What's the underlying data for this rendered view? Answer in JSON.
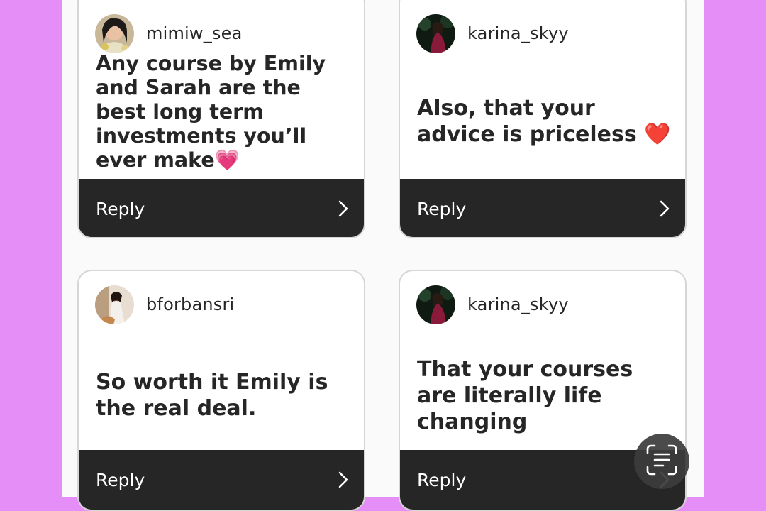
{
  "colors": {
    "background": "#e58ef7",
    "panel": "#fafafa",
    "card": "#ffffff",
    "reply_bar": "#262626",
    "text": "#262626"
  },
  "comments": [
    {
      "username": "mimiw_sea",
      "avatar_icon": "profile-photo",
      "text": "Any course by Emily and Sarah are the best long term investments you’ll ever make",
      "emoji": "💗",
      "reply_label": "Reply"
    },
    {
      "username": "karina_skyy",
      "avatar_icon": "profile-photo",
      "text": "Also, that your advice is priceless ",
      "emoji": "❤️",
      "reply_label": "Reply"
    },
    {
      "username": "bforbansri",
      "avatar_icon": "profile-photo",
      "text": "So worth it Emily is the real deal.",
      "emoji": "",
      "reply_label": "Reply"
    },
    {
      "username": "karina_skyy",
      "avatar_icon": "profile-photo",
      "text": "That your courses are literally life changing",
      "emoji": "",
      "reply_label": "Reply"
    }
  ],
  "overlay": {
    "icon": "live-text-scan-icon"
  }
}
